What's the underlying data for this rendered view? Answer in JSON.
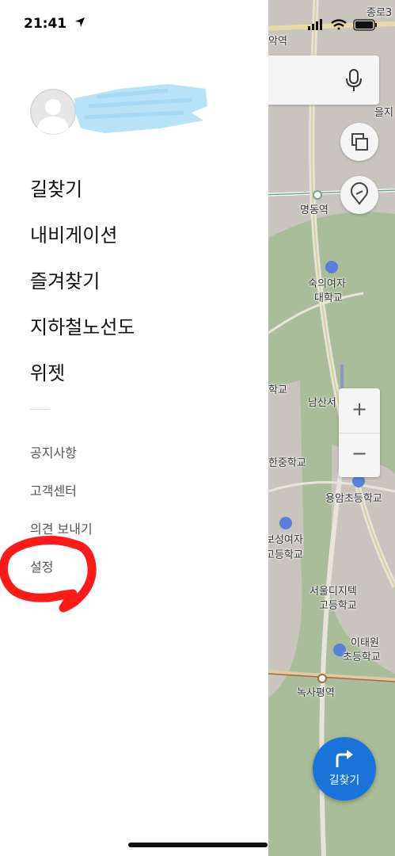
{
  "status_bar": {
    "time": "21:41"
  },
  "drawer": {
    "menu_main": [
      "길찾기",
      "내비게이션",
      "즐겨찾기",
      "지하철노선도",
      "위젯"
    ],
    "menu_sub": [
      "공지사항",
      "고객센터",
      "의견 보내기",
      "설정"
    ]
  },
  "map": {
    "labels": {
      "top_right": "종로3",
      "top_station": "악역",
      "euljiro": "을지",
      "myeongdong": "명동역",
      "sookmyung_1": "숙의여자",
      "sookmyung_2": "대학교",
      "hakgyo": "학교",
      "namsan": "남산서",
      "middle_school": "한중학교",
      "yongam": "용암초등학교",
      "seongyeo_1": "보성여자",
      "seongyeo_2": "고등학교",
      "digital_1": "서울디지텍",
      "digital_2": "고등학교",
      "itaewon_1": "이태원",
      "itaewon_2": "초등학교",
      "noksapyeong": "녹사평역"
    },
    "zoom_in": "+",
    "zoom_out": "−",
    "directions_button": "길찾기"
  },
  "colors": {
    "map_park": "#a9bd9a",
    "map_urban": "#c9c5be",
    "map_road": "#e8e4da",
    "fab": "#1a73d9",
    "annotation": "#ff1a1a",
    "username_blur": "#b7e2f8"
  },
  "icons": [
    "location-arrow-icon",
    "signal-icon",
    "wifi-icon",
    "battery-icon",
    "microphone-icon",
    "layers-icon",
    "location-pin-icon",
    "school-icon",
    "tower-icon",
    "turn-right-arrow-icon"
  ]
}
